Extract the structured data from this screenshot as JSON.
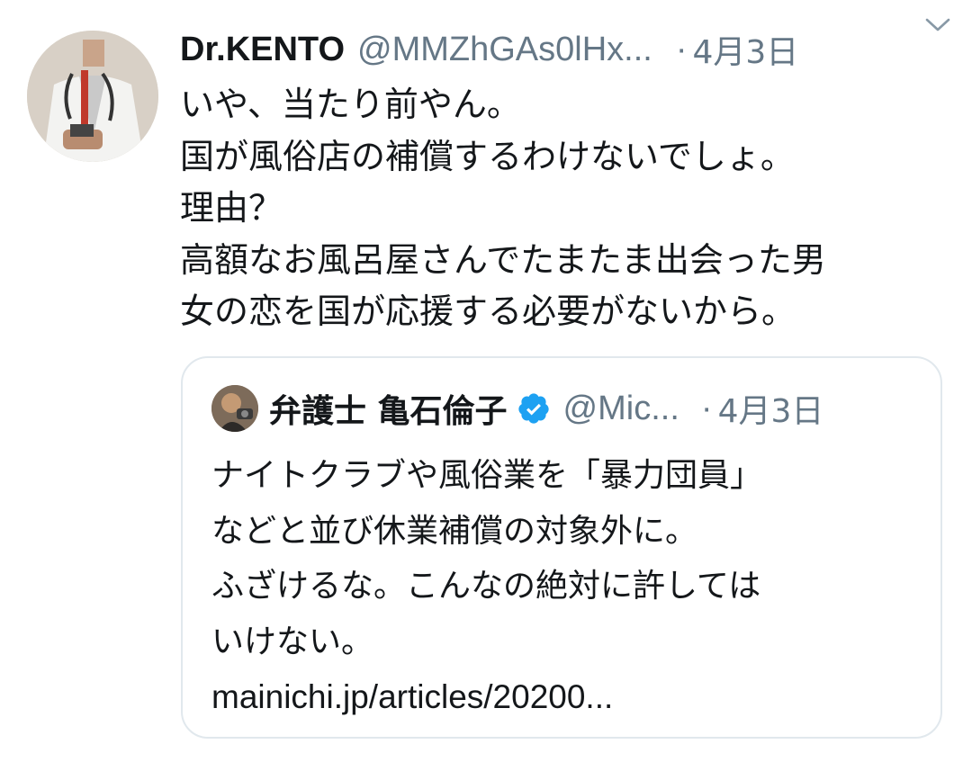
{
  "tweet": {
    "author_name": "Dr.KENTO",
    "author_handle": "@MMZhGAs0lHx...",
    "separator": "·",
    "date": "4月3日",
    "body_lines": [
      "いや、当たり前やん。",
      "国が風俗店の補償するわけないでしょ。",
      "理由？",
      "高額なお風呂屋さんでたまたま出会った男",
      "女の恋を国が応援する必要がないから。"
    ]
  },
  "quoted_tweet": {
    "author_name": "弁護士 亀石倫子",
    "verified": true,
    "author_handle": "@Mic...",
    "separator": "·",
    "date": "4月3日",
    "body_lines": [
      "ナイトクラブや風俗業を「暴力団員」",
      "などと並び休業補償の対象外に。",
      "ふざけるな。こんなの絶対に許しては",
      "いけない。"
    ],
    "link_text": "mainichi.jp/articles/20200..."
  },
  "icons": {
    "menu": "chevron-down-icon",
    "verified": "verified-badge-icon"
  },
  "colors": {
    "text": "#14171a",
    "secondary": "#657786",
    "border": "#e1e8ed",
    "verified": "#1da1f2"
  }
}
